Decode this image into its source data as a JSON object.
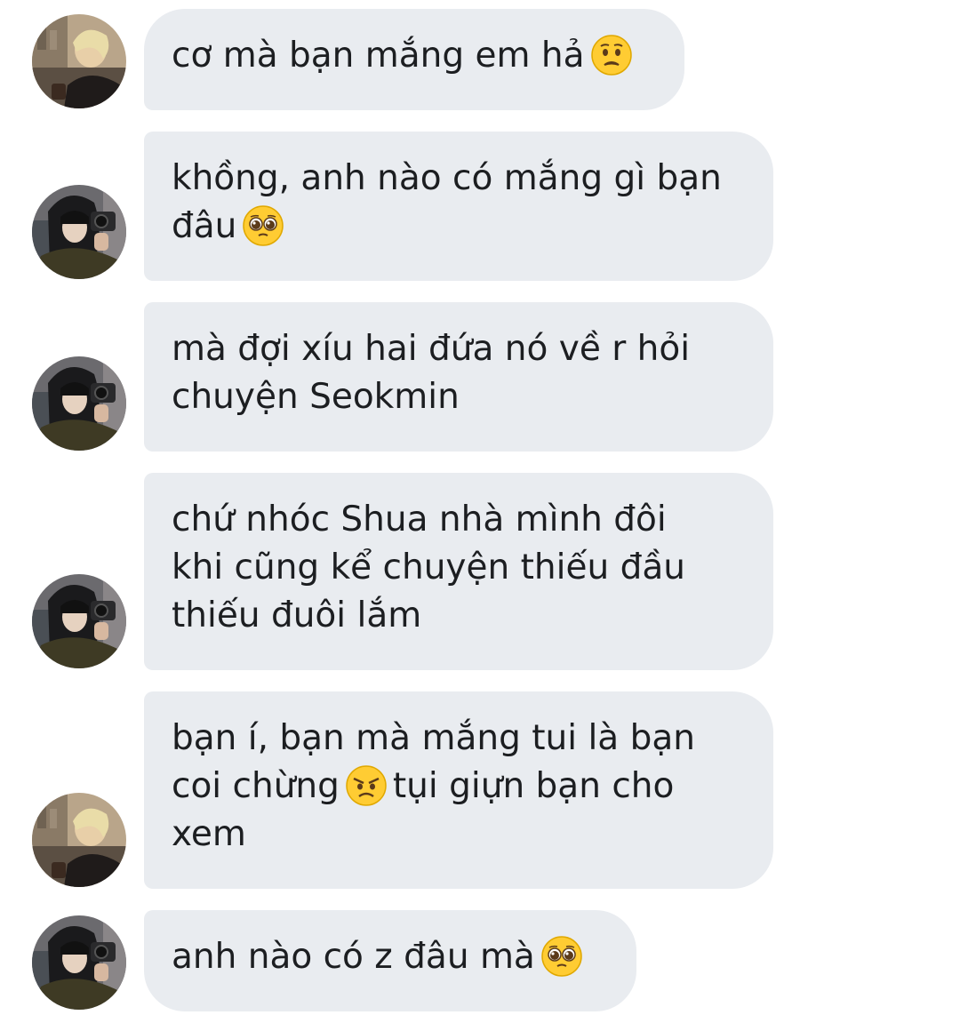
{
  "messages": [
    {
      "avatar": "blonde-avatar",
      "lines": [
        "cơ mà bạn mắng em hả"
      ],
      "emoji": "worried-face-icon"
    },
    {
      "avatar": "hooded-avatar",
      "lines": [
        "khồng, anh nào có mắng gì bạn",
        "đâu"
      ],
      "emoji": "pleading-face-icon"
    },
    {
      "avatar": "hooded-avatar",
      "lines": [
        "mà đợi xíu hai đứa nó về r hỏi",
        "chuyện Seokmin"
      ]
    },
    {
      "avatar": "hooded-avatar",
      "lines": [
        "chứ nhóc Shua nhà mình đôi",
        "khi cũng kể chuyện thiếu đầu",
        "thiếu đuôi lắm"
      ]
    },
    {
      "avatar": "blonde-avatar",
      "lines": [
        "bạn í, bạn mà mắng tui là bạn",
        "coi chừng",
        "tụi giựn bạn cho",
        "xem"
      ],
      "emoji": "angry-face-icon"
    },
    {
      "avatar": "hooded-avatar",
      "lines": [
        "anh nào có z đâu mà"
      ],
      "emoji": "pleading-face-icon"
    }
  ],
  "colors": {
    "bubble_bg": "#e9ecf0",
    "text": "#1c1e21",
    "emoji_yellow": "#ffcc33"
  }
}
